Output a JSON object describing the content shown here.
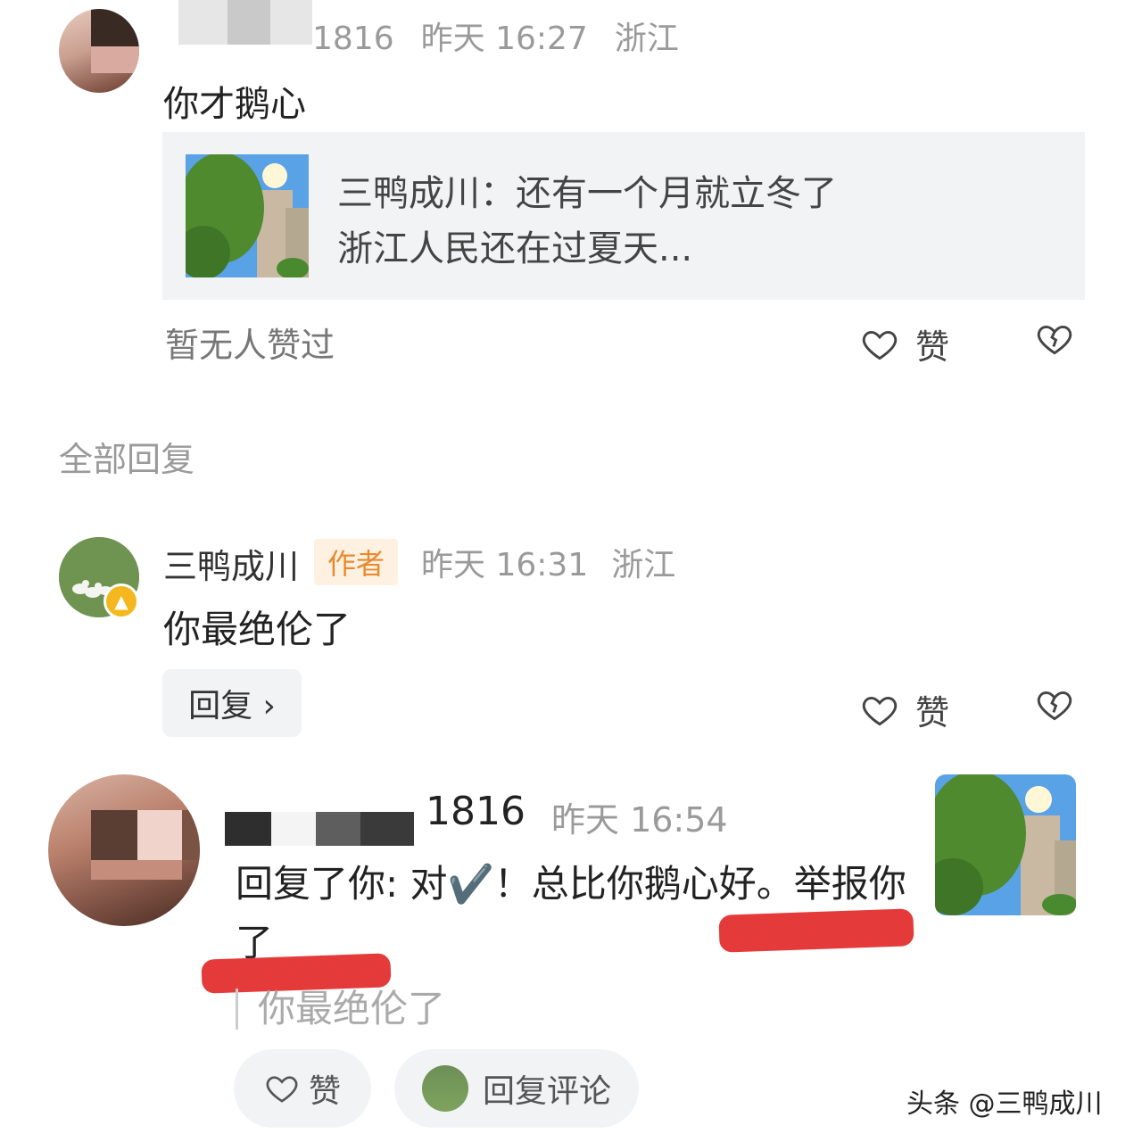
{
  "top_comment": {
    "username_visible": "1816",
    "time": "昨天 16:27",
    "location": "浙江",
    "text": "你才鹅心",
    "quote": {
      "line1": "三鸭成川：还有一个月就立冬了",
      "line2": "浙江人民还在过夏天..."
    },
    "likes_status": "暂无人赞过",
    "like_label": "赞"
  },
  "section_title": "全部回复",
  "author_reply": {
    "name": "三鸭成川",
    "tag": "作者",
    "time": "昨天 16:31",
    "location": "浙江",
    "text": "你最绝伦了",
    "reply_button": "回复 ›",
    "like_label": "赞"
  },
  "third_comment": {
    "username_visible": "1816",
    "time": "昨天 16:54",
    "text": "回复了你: 对✔️！总比你鹅心好。举报你了",
    "quoted": "你最绝伦了",
    "like_label": "赞",
    "reply_comment_label": "回复评论"
  },
  "watermark": "头条 @三鸭成川",
  "colors": {
    "background": "#ffffff",
    "card_bg": "#f2f3f5",
    "muted_text": "#9a9a9a",
    "author_tag_text": "#e8892d",
    "author_tag_bg": "#fff1e2",
    "highlight_mark": "#e53a3a"
  }
}
